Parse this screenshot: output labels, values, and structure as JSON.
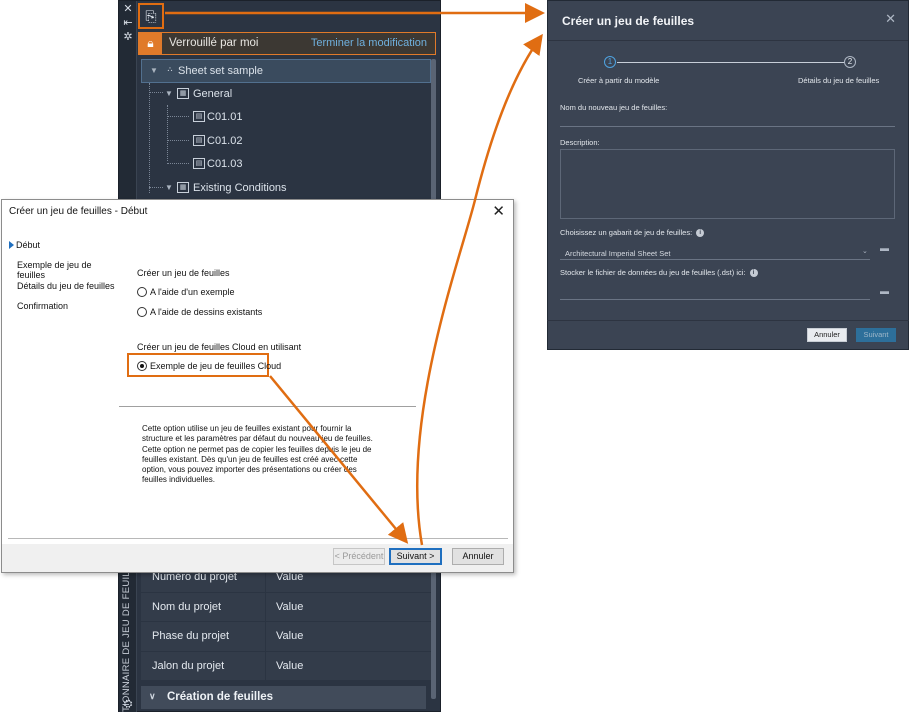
{
  "palette": {
    "vertical_title": "GESTIONNAIRE DE JEU DE FEUILLES",
    "lock_text": "Verrouillé par moi",
    "lock_action": "Terminer la modification",
    "tree": {
      "root": "Sheet set sample",
      "group1": "General",
      "sheets": [
        "C01.01",
        "C01.02",
        "C01.03"
      ],
      "group2": "Existing Conditions"
    },
    "properties": [
      {
        "key": "Numéro du projet",
        "value": "Value"
      },
      {
        "key": "Nom du projet",
        "value": "Value"
      },
      {
        "key": "Phase du projet",
        "value": "Value"
      },
      {
        "key": "Jalon du projet",
        "value": "Value"
      }
    ],
    "section": "Création de feuilles"
  },
  "dialog": {
    "title": "Créer un jeu de feuilles - Début",
    "steps": [
      "Début",
      "Exemple de jeu de feuilles",
      "Détails du jeu de feuilles",
      "Confirmation"
    ],
    "group1_label": "Créer un jeu de feuilles",
    "option1": "A l'aide d'un exemple",
    "option2": "A l'aide de dessins existants",
    "group2_label": "Créer un jeu de feuilles Cloud en utilisant",
    "option3": "Exemple de jeu de feuilles Cloud",
    "description": "Cette option utilise un jeu de feuilles existant pour fournir la structure et les paramètres par défaut du nouveau jeu de feuilles. Cette option ne permet pas de copier les feuilles depuis le jeu de feuilles existant. Dès qu'un jeu de feuilles est créé avec cette option, vous pouvez importer des présentations ou créer des feuilles individuelles.",
    "btn_prev": "< Précédent",
    "btn_next": "Suivant >",
    "btn_cancel": "Annuler"
  },
  "web": {
    "title": "Créer un jeu de feuilles",
    "step1_num": "1",
    "step1_label": "Créer à partir du modèle",
    "step2_num": "2",
    "step2_label": "Détails du jeu de feuilles",
    "name_label": "Nom du nouveau jeu de feuilles:",
    "desc_label": "Description:",
    "template_label": "Choisissez un gabarit de jeu de feuilles:",
    "template_value": "Architectural Imperial Sheet Set",
    "store_label": "Stocker le fichier de données du jeu de feuilles (.dst) ici:",
    "btn_cancel": "Annuler",
    "btn_next": "Suivant"
  },
  "colors": {
    "accent_orange": "#e06d12",
    "dark_panel": "#2b3442",
    "web_dialog": "#3b4453",
    "link_blue": "#6fb0de"
  }
}
